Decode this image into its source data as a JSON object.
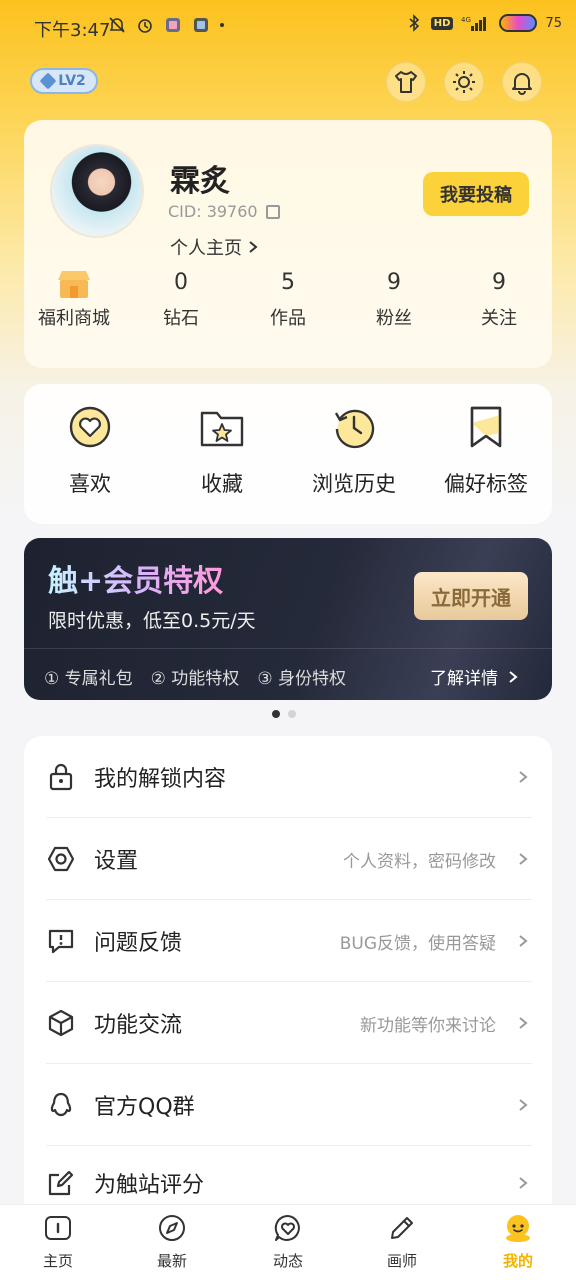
{
  "status_bar": {
    "time": "下午3:47",
    "hd": "HD",
    "signal": "4G",
    "battery": "75"
  },
  "header": {
    "level_badge": "LV2",
    "icons": [
      "shirt-icon",
      "sun-icon",
      "bell-icon"
    ]
  },
  "profile": {
    "username": "霖炙",
    "cid": "CID: 39760",
    "homepage_link": "个人主页",
    "submit_button": "我要投稿",
    "stats": [
      {
        "value": "",
        "label": "福利商城",
        "icon": "shop-icon"
      },
      {
        "value": "0",
        "label": "钻石"
      },
      {
        "value": "5",
        "label": "作品"
      },
      {
        "value": "9",
        "label": "粉丝"
      },
      {
        "value": "9",
        "label": "关注"
      }
    ]
  },
  "quick_actions": [
    {
      "label": "喜欢",
      "icon": "heart-icon"
    },
    {
      "label": "收藏",
      "icon": "folder-star-icon"
    },
    {
      "label": "浏览历史",
      "icon": "history-icon"
    },
    {
      "label": "偏好标签",
      "icon": "bookmark-icon"
    }
  ],
  "vip": {
    "title": "触+会员特权",
    "subtitle": "限时优惠，低至0.5元/天",
    "button": "立即开通",
    "perks": [
      "① 专属礼包",
      "② 功能特权",
      "③ 身份特权"
    ],
    "more": "了解详情"
  },
  "menu": [
    {
      "title": "我的解锁内容",
      "desc": "",
      "icon": "lock-icon"
    },
    {
      "title": "设置",
      "desc": "个人资料，密码修改",
      "icon": "settings-icon"
    },
    {
      "title": "问题反馈",
      "desc": "BUG反馈，使用答疑",
      "icon": "feedback-icon"
    },
    {
      "title": "功能交流",
      "desc": "新功能等你来讨论",
      "icon": "cube-icon"
    },
    {
      "title": "官方QQ群",
      "desc": "",
      "icon": "qq-icon"
    },
    {
      "title": "为触站评分",
      "desc": "",
      "icon": "edit-icon"
    }
  ],
  "bottom_nav": [
    {
      "label": "主页",
      "icon": "home-icon"
    },
    {
      "label": "最新",
      "icon": "compass-icon"
    },
    {
      "label": "动态",
      "icon": "heart-chat-icon"
    },
    {
      "label": "画师",
      "icon": "pencil-icon"
    },
    {
      "label": "我的",
      "icon": "profile-icon",
      "active": true
    }
  ],
  "colors": {
    "accent": "#fcd23a",
    "active_nav": "#f2b400",
    "vip_bg": "#1e2230"
  }
}
